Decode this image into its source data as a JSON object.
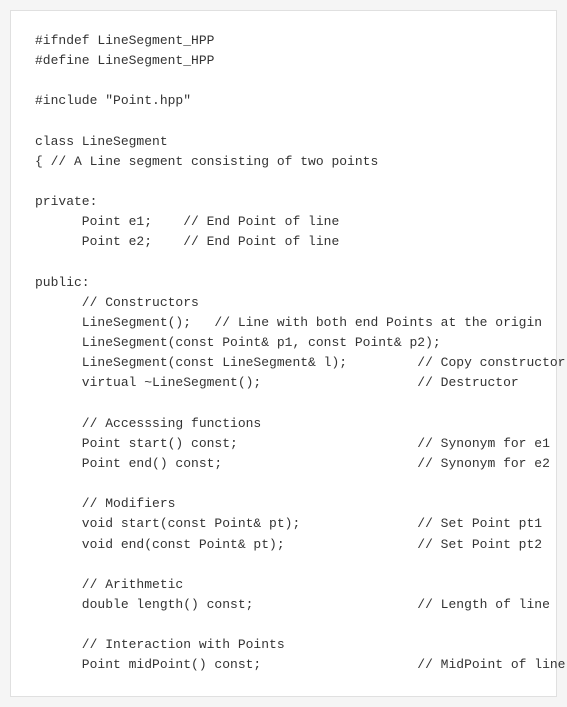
{
  "code": {
    "lines": [
      {
        "id": "line1",
        "text": "#ifndef LineSegment_HPP"
      },
      {
        "id": "line2",
        "text": "#define LineSegment_HPP"
      },
      {
        "id": "line3",
        "text": ""
      },
      {
        "id": "line4",
        "text": "#include \"Point.hpp\""
      },
      {
        "id": "line5",
        "text": ""
      },
      {
        "id": "line6",
        "text": "class LineSegment"
      },
      {
        "id": "line7",
        "text": "{ // A Line segment consisting of two points"
      },
      {
        "id": "line8",
        "text": ""
      },
      {
        "id": "line9",
        "text": "private:"
      },
      {
        "id": "line10",
        "text": "      Point e1;    // End Point of line"
      },
      {
        "id": "line11",
        "text": "      Point e2;    // End Point of line"
      },
      {
        "id": "line12",
        "text": ""
      },
      {
        "id": "line13",
        "text": "public:"
      },
      {
        "id": "line14",
        "text": "      // Constructors"
      },
      {
        "id": "line15",
        "text": "      LineSegment();   // Line with both end Points at the origin"
      },
      {
        "id": "line16",
        "text": "      LineSegment(const Point& p1, const Point& p2);"
      },
      {
        "id": "line17",
        "text": "      LineSegment(const LineSegment& l);         // Copy constructor"
      },
      {
        "id": "line18",
        "text": "      virtual ~LineSegment();                    // Destructor"
      },
      {
        "id": "line19",
        "text": ""
      },
      {
        "id": "line20",
        "text": "      // Accesssing functions"
      },
      {
        "id": "line21",
        "text": "      Point start() const;                       // Synonym for e1"
      },
      {
        "id": "line22",
        "text": "      Point end() const;                         // Synonym for e2"
      },
      {
        "id": "line23",
        "text": ""
      },
      {
        "id": "line24",
        "text": "      // Modifiers"
      },
      {
        "id": "line25",
        "text": "      void start(const Point& pt);               // Set Point pt1"
      },
      {
        "id": "line26",
        "text": "      void end(const Point& pt);                 // Set Point pt2"
      },
      {
        "id": "line27",
        "text": ""
      },
      {
        "id": "line28",
        "text": "      // Arithmetic"
      },
      {
        "id": "line29",
        "text": "      double length() const;                     // Length of line"
      },
      {
        "id": "line30",
        "text": ""
      },
      {
        "id": "line31",
        "text": "      // Interaction with Points"
      },
      {
        "id": "line32",
        "text": "      Point midPoint() const;                    // MidPoint of line"
      }
    ]
  }
}
